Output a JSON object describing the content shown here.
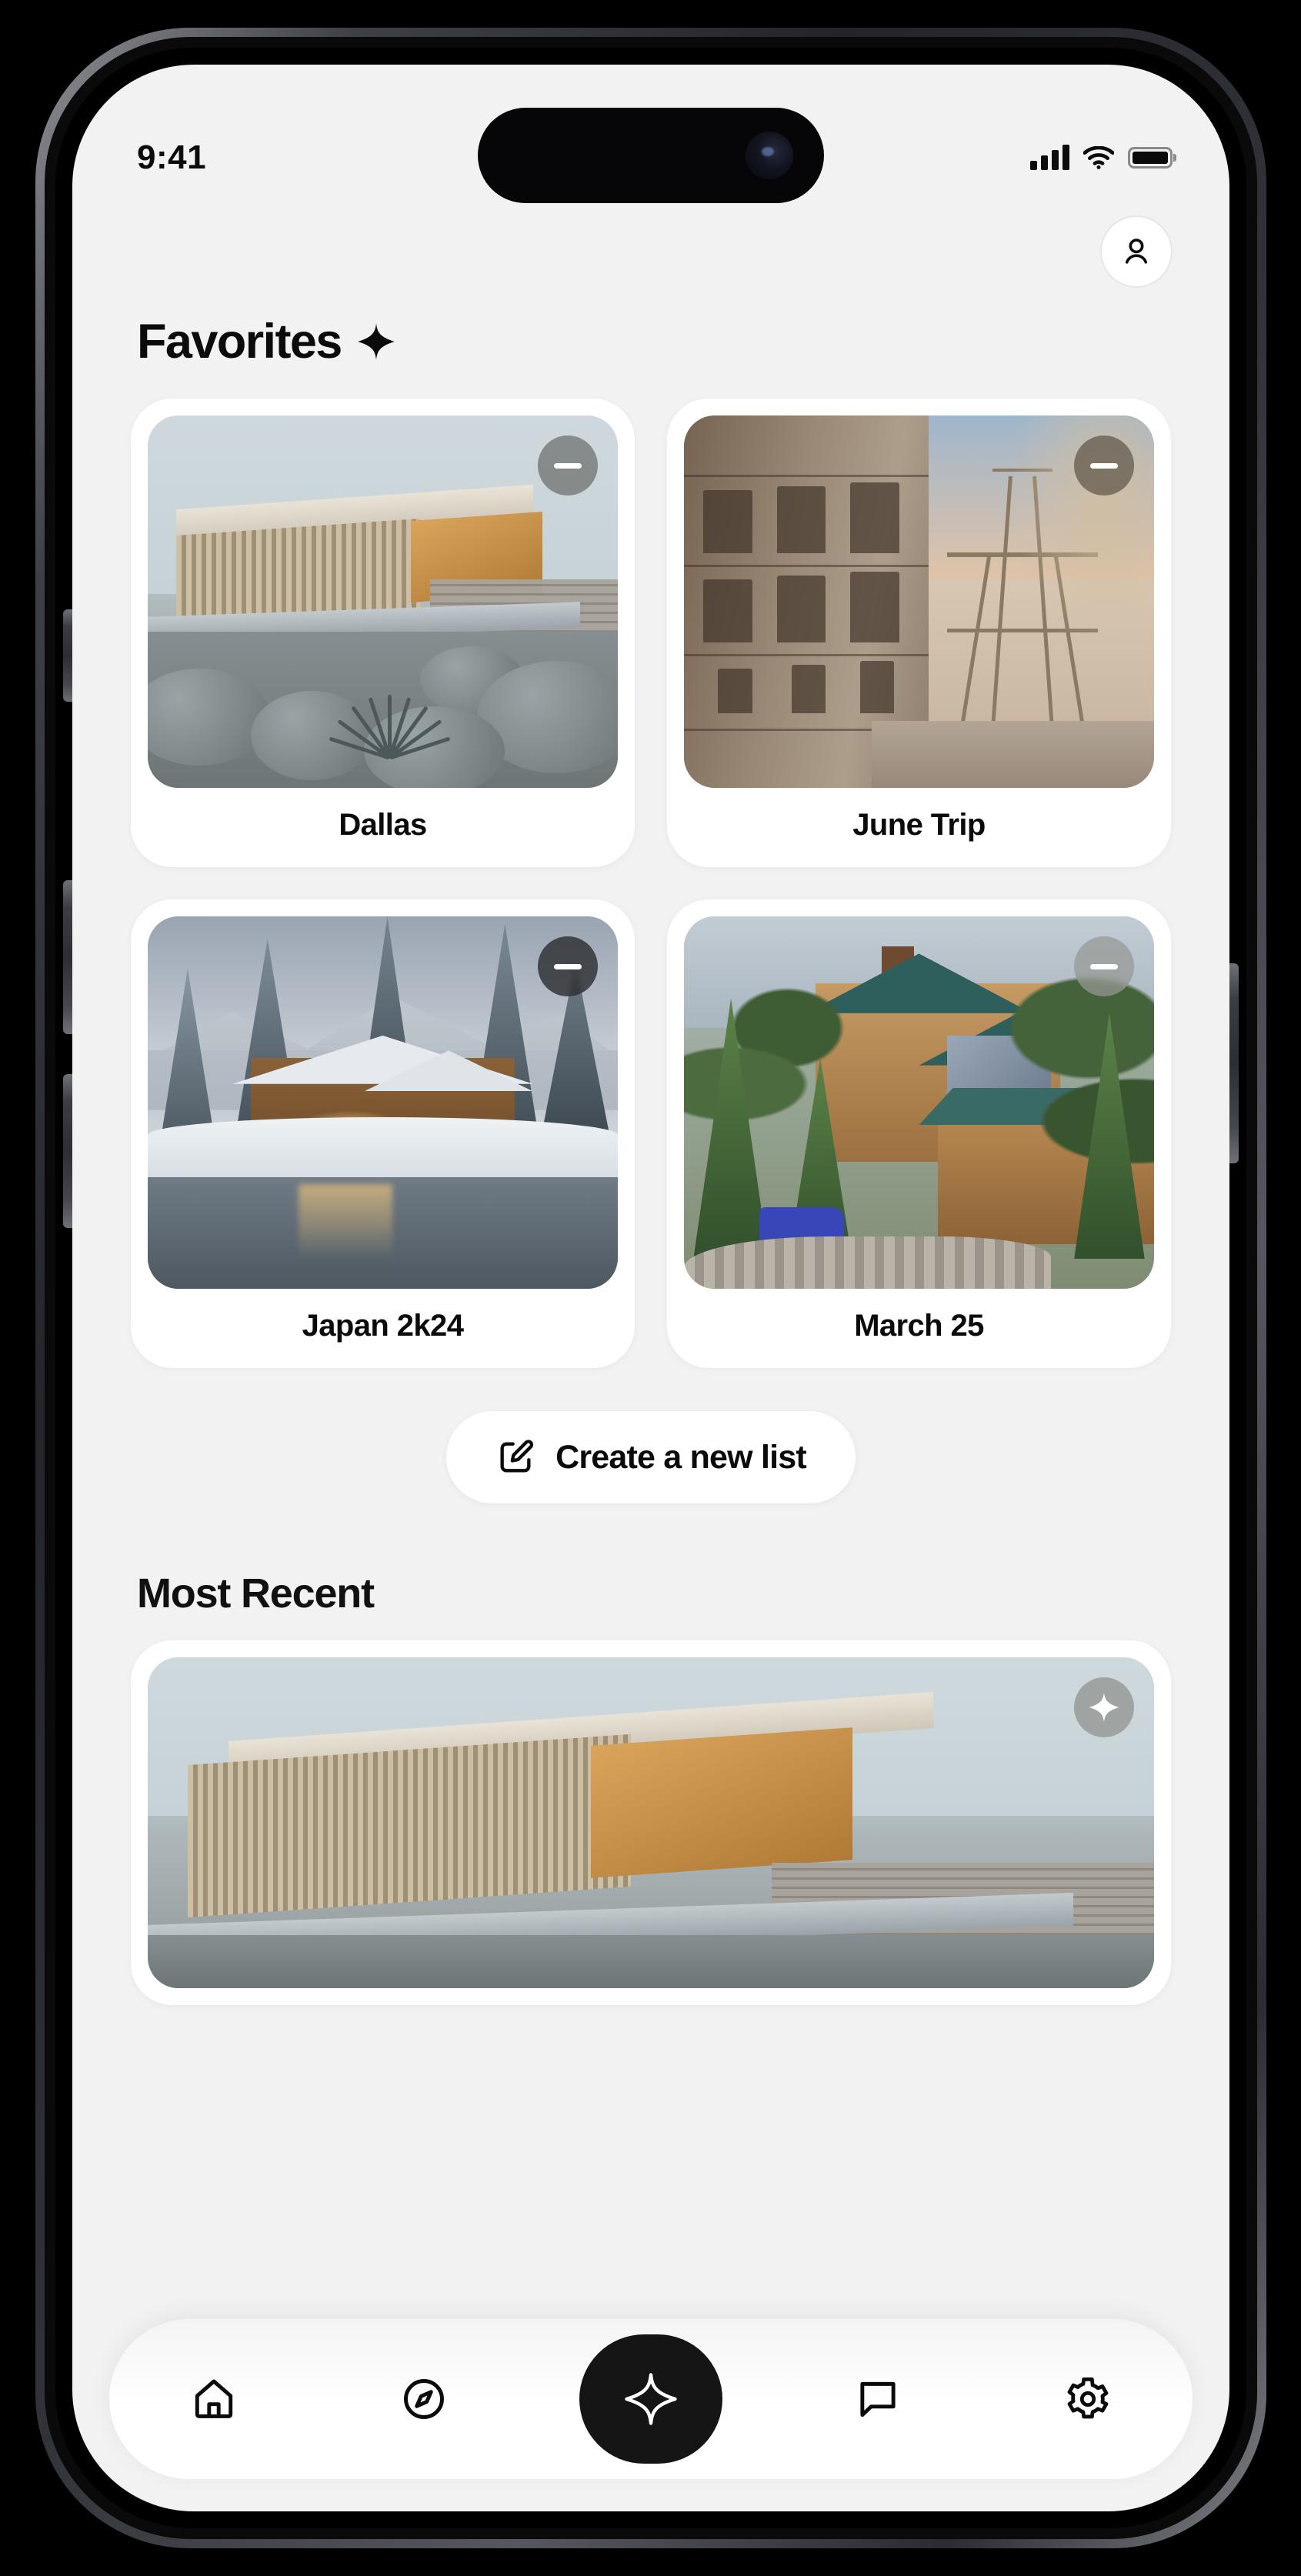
{
  "status_bar": {
    "time": "9:41",
    "signal_icon": "cellular-signal-icon",
    "wifi_icon": "wifi-icon",
    "battery_icon": "battery-full-icon"
  },
  "header": {
    "profile_icon": "user-avatar-icon",
    "title": "Favorites",
    "title_icon": "sparkle-icon"
  },
  "favorites": {
    "remove_icon": "minus-icon",
    "cards": [
      {
        "label": "Dallas",
        "photo": "modern-desert-house",
        "remove_label": "Remove from favorites"
      },
      {
        "label": "June Trip",
        "photo": "eiffel-tower-paris-street",
        "remove_label": "Remove from favorites"
      },
      {
        "label": "Japan 2k24",
        "photo": "snowy-lakeside-lodge",
        "remove_label": "Remove from favorites"
      },
      {
        "label": "March 25",
        "photo": "cedar-mountain-lodge",
        "remove_label": "Remove from favorites"
      }
    ]
  },
  "create_list": {
    "label": "Create a new list",
    "icon": "edit-square-pencil-icon"
  },
  "most_recent": {
    "title": "Most Recent",
    "card": {
      "photo": "modern-desert-house",
      "favorite_icon": "sparkle-filled-icon",
      "favorite_label": "Add to favorites"
    }
  },
  "tabbar": {
    "items": [
      {
        "name": "home",
        "icon": "home-icon",
        "active": false
      },
      {
        "name": "explore",
        "icon": "compass-icon",
        "active": false
      },
      {
        "name": "favorites",
        "icon": "sparkle-icon",
        "active": true
      },
      {
        "name": "messages",
        "icon": "chat-bubble-icon",
        "active": false
      },
      {
        "name": "settings",
        "icon": "gear-icon",
        "active": false
      }
    ]
  },
  "colors": {
    "screen_background": "#f2f2f2",
    "card_background": "#ffffff",
    "text_primary": "#0b0b0b",
    "accent_active": "#151515"
  }
}
